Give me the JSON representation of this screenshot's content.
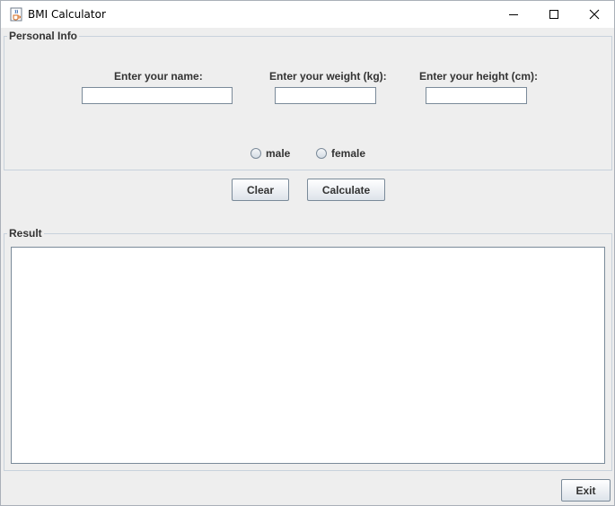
{
  "window": {
    "title": "BMI Calculator",
    "app_icon": "java-cup-icon",
    "controls": {
      "minimize": "minimize-icon",
      "maximize": "maximize-icon",
      "close": "close-icon"
    }
  },
  "personal_info": {
    "title": "Personal Info",
    "name_label": "Enter your name:",
    "name_value": "",
    "weight_label": "Enter your weight (kg):",
    "weight_value": "",
    "height_label": "Enter your height (cm):",
    "height_value": "",
    "gender_options": [
      "male",
      "female"
    ]
  },
  "actions": {
    "clear_label": "Clear",
    "calculate_label": "Calculate"
  },
  "result": {
    "title": "Result",
    "text": ""
  },
  "footer": {
    "exit_label": "Exit"
  }
}
